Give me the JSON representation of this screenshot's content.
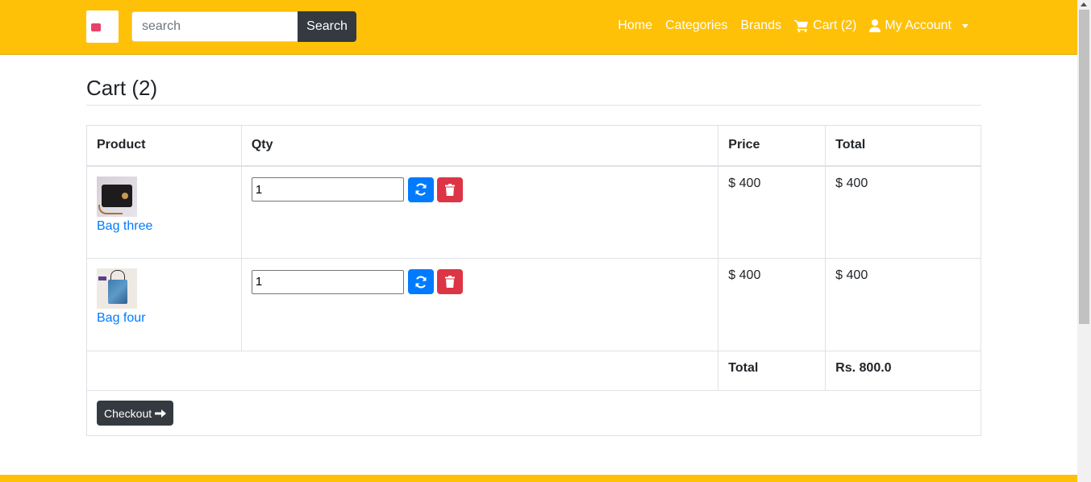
{
  "header": {
    "search_placeholder": "search",
    "search_button": "Search",
    "nav": {
      "home": "Home",
      "categories": "Categories",
      "brands": "Brands",
      "cart": "Cart (2)",
      "account": "My Account"
    }
  },
  "page": {
    "title": "Cart (2)"
  },
  "table": {
    "headers": [
      "Product",
      "Qty",
      "Price",
      "Total"
    ],
    "rows": [
      {
        "name": "Bag three",
        "qty": "1",
        "price": "$ 400",
        "total": "$ 400"
      },
      {
        "name": "Bag four",
        "qty": "1",
        "price": "$ 400",
        "total": "$ 400"
      }
    ],
    "total_label": "Total",
    "grand_total": "Rs. 800.0"
  },
  "checkout_label": "Checkout",
  "colors": {
    "navbar": "#ffc107",
    "refresh_button": "#007bff",
    "delete_button": "#dc3545",
    "dark_button": "#343a40",
    "link": "#007bff"
  },
  "icons": {
    "cart": "cart-icon",
    "account": "user-icon",
    "refresh": "refresh-icon",
    "delete": "trash-icon",
    "checkout": "arrow-right-icon"
  }
}
